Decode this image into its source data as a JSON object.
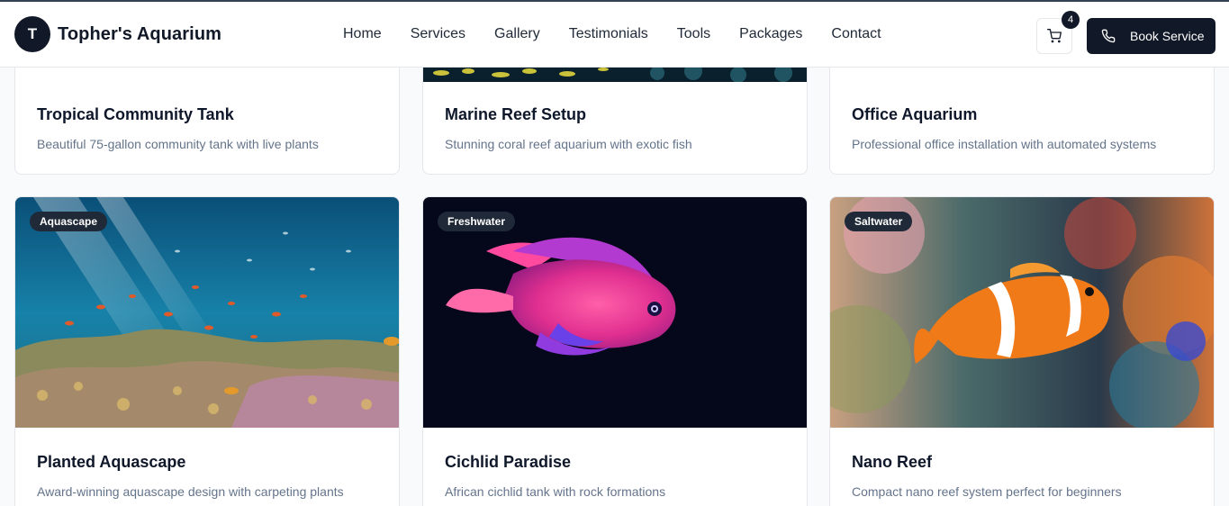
{
  "header": {
    "logo_letter": "T",
    "brand": "Topher's Aquarium",
    "nav": [
      {
        "label": "Home"
      },
      {
        "label": "Services"
      },
      {
        "label": "Gallery"
      },
      {
        "label": "Testimonials"
      },
      {
        "label": "Tools"
      },
      {
        "label": "Packages"
      },
      {
        "label": "Contact"
      }
    ],
    "cart_count": "4",
    "book_label": "Book Service"
  },
  "gallery": {
    "row1": [
      {
        "title": "Tropical Community Tank",
        "desc": "Beautiful 75-gallon community tank with live plants"
      },
      {
        "title": "Marine Reef Setup",
        "desc": "Stunning coral reef aquarium with exotic fish"
      },
      {
        "title": "Office Aquarium",
        "desc": "Professional office installation with automated systems"
      }
    ],
    "row2": [
      {
        "badge": "Aquascape",
        "title": "Planted Aquascape",
        "desc": "Award-winning aquascape design with carpeting plants"
      },
      {
        "badge": "Freshwater",
        "title": "Cichlid Paradise",
        "desc": "African cichlid tank with rock formations"
      },
      {
        "badge": "Saltwater",
        "title": "Nano Reef",
        "desc": "Compact nano reef system perfect for beginners"
      }
    ]
  },
  "colors": {
    "primary": "#111827",
    "muted_text": "#64748b",
    "border": "#e5e7eb"
  },
  "icons": {
    "cart": "shopping-cart-icon",
    "phone": "phone-icon"
  }
}
